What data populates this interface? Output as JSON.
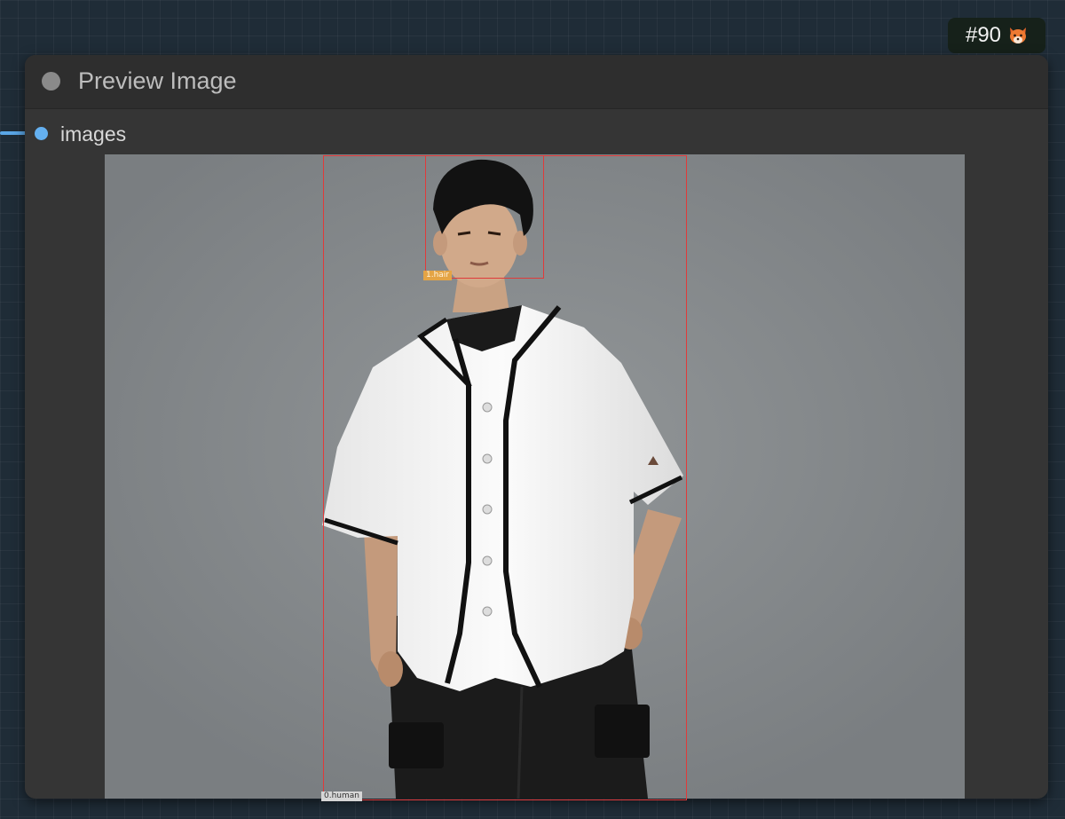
{
  "badge": {
    "text": "#90",
    "icon": "fox-face-icon"
  },
  "node": {
    "title": "Preview Image",
    "input_slot": "images"
  },
  "preview": {
    "detections": [
      {
        "label": "1.hair"
      },
      {
        "label": "0.human"
      }
    ]
  },
  "colors": {
    "canvas_bg": "#1f2c37",
    "node_bg": "#353535",
    "slot_color": "#64b0f0",
    "bbox_color": "#e03a3a",
    "hair_label_bg": "#e4a445"
  }
}
